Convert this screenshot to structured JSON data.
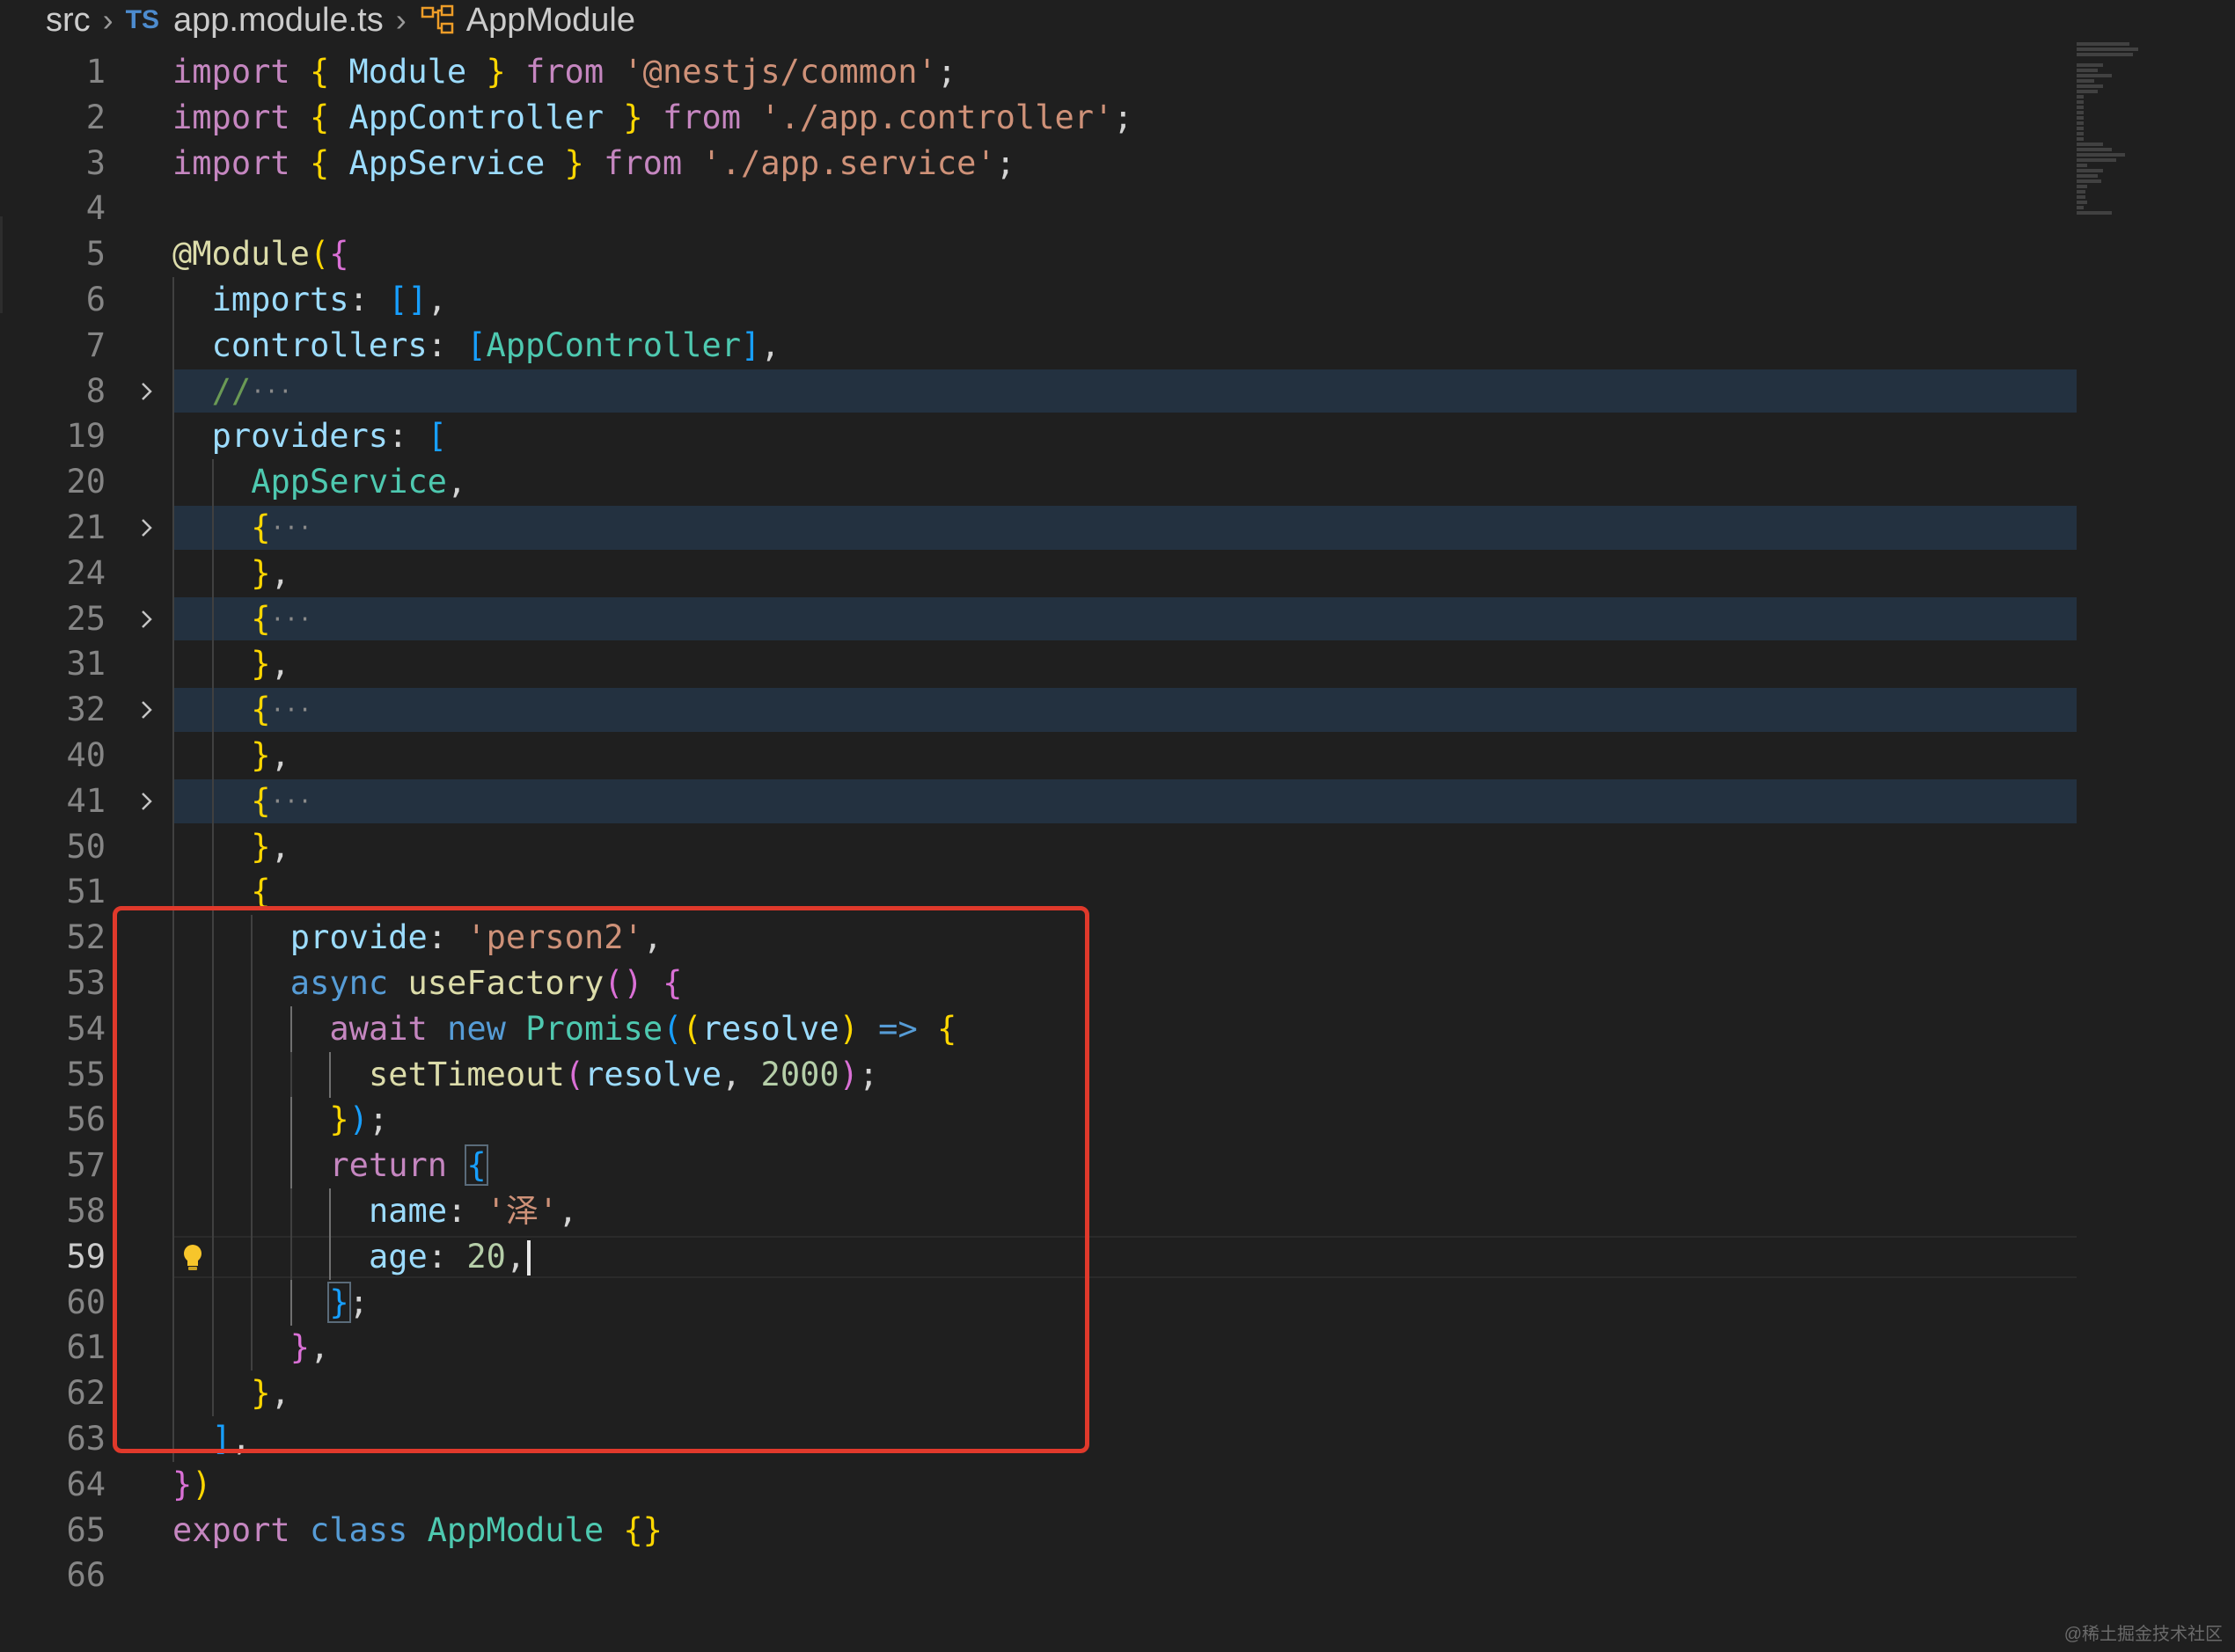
{
  "breadcrumb": {
    "folder": "src",
    "file_badge": "TS",
    "file": "app.module.ts",
    "symbol": "AppModule"
  },
  "code_lines": [
    {
      "n": "1",
      "indent": 0,
      "tokens": [
        [
          "k-ctrl",
          "import"
        ],
        [
          "t-punc",
          " "
        ],
        [
          "b1",
          "{"
        ],
        [
          "t-punc",
          " "
        ],
        [
          "t-var",
          "Module"
        ],
        [
          "t-punc",
          " "
        ],
        [
          "b1",
          "}"
        ],
        [
          "t-punc",
          " "
        ],
        [
          "k-ctrl",
          "from"
        ],
        [
          "t-punc",
          " "
        ],
        [
          "t-str",
          "'@nestjs/common'"
        ],
        [
          "t-punc",
          ";"
        ]
      ]
    },
    {
      "n": "2",
      "indent": 0,
      "tokens": [
        [
          "k-ctrl",
          "import"
        ],
        [
          "t-punc",
          " "
        ],
        [
          "b1",
          "{"
        ],
        [
          "t-punc",
          " "
        ],
        [
          "t-var",
          "AppController"
        ],
        [
          "t-punc",
          " "
        ],
        [
          "b1",
          "}"
        ],
        [
          "t-punc",
          " "
        ],
        [
          "k-ctrl",
          "from"
        ],
        [
          "t-punc",
          " "
        ],
        [
          "t-str",
          "'./app.controller'"
        ],
        [
          "t-punc",
          ";"
        ]
      ]
    },
    {
      "n": "3",
      "indent": 0,
      "tokens": [
        [
          "k-ctrl",
          "import"
        ],
        [
          "t-punc",
          " "
        ],
        [
          "b1",
          "{"
        ],
        [
          "t-punc",
          " "
        ],
        [
          "t-var",
          "AppService"
        ],
        [
          "t-punc",
          " "
        ],
        [
          "b1",
          "}"
        ],
        [
          "t-punc",
          " "
        ],
        [
          "k-ctrl",
          "from"
        ],
        [
          "t-punc",
          " "
        ],
        [
          "t-str",
          "'./app.service'"
        ],
        [
          "t-punc",
          ";"
        ]
      ]
    },
    {
      "n": "4",
      "indent": 0,
      "tokens": []
    },
    {
      "n": "5",
      "indent": 0,
      "tokens": [
        [
          "t-fn",
          "@Module"
        ],
        [
          "b1",
          "("
        ],
        [
          "b2",
          "{"
        ]
      ]
    },
    {
      "n": "6",
      "indent": 1,
      "tokens": [
        [
          "t-var",
          "imports"
        ],
        [
          "t-punc",
          ": "
        ],
        [
          "b3",
          "[]"
        ],
        [
          "t-punc",
          ","
        ]
      ]
    },
    {
      "n": "7",
      "indent": 1,
      "tokens": [
        [
          "t-var",
          "controllers"
        ],
        [
          "t-punc",
          ": "
        ],
        [
          "b3",
          "["
        ],
        [
          "t-type",
          "AppController"
        ],
        [
          "b3",
          "]"
        ],
        [
          "t-punc",
          ","
        ]
      ]
    },
    {
      "n": "8",
      "indent": 1,
      "fold": true,
      "folded": true,
      "tokens": [
        [
          "t-com",
          "//"
        ],
        [
          "ellip",
          "···"
        ]
      ]
    },
    {
      "n": "19",
      "indent": 1,
      "tokens": [
        [
          "t-var",
          "providers"
        ],
        [
          "t-punc",
          ": "
        ],
        [
          "b3",
          "["
        ]
      ]
    },
    {
      "n": "20",
      "indent": 2,
      "tokens": [
        [
          "t-type",
          "AppService"
        ],
        [
          "t-punc",
          ","
        ]
      ]
    },
    {
      "n": "21",
      "indent": 2,
      "fold": true,
      "folded": true,
      "tokens": [
        [
          "b1",
          "{"
        ],
        [
          "ellip",
          "···"
        ]
      ]
    },
    {
      "n": "24",
      "indent": 2,
      "tokens": [
        [
          "b1",
          "}"
        ],
        [
          "t-punc",
          ","
        ]
      ]
    },
    {
      "n": "25",
      "indent": 2,
      "fold": true,
      "folded": true,
      "tokens": [
        [
          "b1",
          "{"
        ],
        [
          "ellip",
          "···"
        ]
      ]
    },
    {
      "n": "31",
      "indent": 2,
      "tokens": [
        [
          "b1",
          "}"
        ],
        [
          "t-punc",
          ","
        ]
      ]
    },
    {
      "n": "32",
      "indent": 2,
      "fold": true,
      "folded": true,
      "tokens": [
        [
          "b1",
          "{"
        ],
        [
          "ellip",
          "···"
        ]
      ]
    },
    {
      "n": "40",
      "indent": 2,
      "tokens": [
        [
          "b1",
          "}"
        ],
        [
          "t-punc",
          ","
        ]
      ]
    },
    {
      "n": "41",
      "indent": 2,
      "fold": true,
      "folded": true,
      "tokens": [
        [
          "b1",
          "{"
        ],
        [
          "ellip",
          "···"
        ]
      ]
    },
    {
      "n": "50",
      "indent": 2,
      "tokens": [
        [
          "b1",
          "}"
        ],
        [
          "t-punc",
          ","
        ]
      ]
    },
    {
      "n": "51",
      "indent": 2,
      "tokens": [
        [
          "b1",
          "{"
        ]
      ]
    },
    {
      "n": "52",
      "indent": 3,
      "tokens": [
        [
          "t-var",
          "provide"
        ],
        [
          "t-punc",
          ": "
        ],
        [
          "t-str",
          "'person2'"
        ],
        [
          "t-punc",
          ","
        ]
      ]
    },
    {
      "n": "53",
      "indent": 3,
      "tokens": [
        [
          "k-store",
          "async"
        ],
        [
          "t-punc",
          " "
        ],
        [
          "t-fn",
          "useFactory"
        ],
        [
          "b2",
          "()"
        ],
        [
          "t-punc",
          " "
        ],
        [
          "b2",
          "{"
        ]
      ]
    },
    {
      "n": "54",
      "indent": 4,
      "tokens": [
        [
          "k-ctrl",
          "await"
        ],
        [
          "t-punc",
          " "
        ],
        [
          "k-store",
          "new"
        ],
        [
          "t-punc",
          " "
        ],
        [
          "t-type",
          "Promise"
        ],
        [
          "b3",
          "("
        ],
        [
          "b1",
          "("
        ],
        [
          "t-var",
          "resolve"
        ],
        [
          "b1",
          ")"
        ],
        [
          "t-punc",
          " "
        ],
        [
          "k-store",
          "=>"
        ],
        [
          "t-punc",
          " "
        ],
        [
          "b1",
          "{"
        ]
      ]
    },
    {
      "n": "55",
      "indent": 5,
      "tokens": [
        [
          "t-fn",
          "setTimeout"
        ],
        [
          "b2",
          "("
        ],
        [
          "t-var",
          "resolve"
        ],
        [
          "t-punc",
          ", "
        ],
        [
          "t-num",
          "2000"
        ],
        [
          "b2",
          ")"
        ],
        [
          "t-punc",
          ";"
        ]
      ]
    },
    {
      "n": "56",
      "indent": 4,
      "tokens": [
        [
          "b1",
          "}"
        ],
        [
          "b3",
          ")"
        ],
        [
          "t-punc",
          ";"
        ]
      ]
    },
    {
      "n": "57",
      "indent": 4,
      "tokens": [
        [
          "k-ctrl",
          "return"
        ],
        [
          "t-punc",
          " "
        ],
        [
          "b3",
          "{"
        ]
      ]
    },
    {
      "n": "58",
      "indent": 5,
      "tokens": [
        [
          "t-var",
          "name"
        ],
        [
          "t-punc",
          ": "
        ],
        [
          "t-str",
          "'泽'"
        ],
        [
          "t-punc",
          ","
        ]
      ]
    },
    {
      "n": "59",
      "indent": 5,
      "current": true,
      "bulb": true,
      "cursor": true,
      "tokens": [
        [
          "t-var",
          "age"
        ],
        [
          "t-punc",
          ": "
        ],
        [
          "t-num",
          "20"
        ],
        [
          "t-punc",
          ","
        ]
      ]
    },
    {
      "n": "60",
      "indent": 4,
      "tokens": [
        [
          "b3",
          "}"
        ],
        [
          "t-punc",
          ";"
        ]
      ]
    },
    {
      "n": "61",
      "indent": 3,
      "tokens": [
        [
          "b2",
          "}"
        ],
        [
          "t-punc",
          ","
        ]
      ]
    },
    {
      "n": "62",
      "indent": 2,
      "tokens": [
        [
          "b1",
          "}"
        ],
        [
          "t-punc",
          ","
        ]
      ]
    },
    {
      "n": "63",
      "indent": 1,
      "tokens": [
        [
          "b3",
          "]"
        ],
        [
          "t-punc",
          ","
        ]
      ]
    },
    {
      "n": "64",
      "indent": 0,
      "tokens": [
        [
          "b2",
          "}"
        ],
        [
          "b1",
          ")"
        ]
      ]
    },
    {
      "n": "65",
      "indent": 0,
      "tokens": [
        [
          "k-ctrl",
          "export"
        ],
        [
          "t-punc",
          " "
        ],
        [
          "k-store",
          "class"
        ],
        [
          "t-punc",
          " "
        ],
        [
          "t-type",
          "AppModule"
        ],
        [
          "t-punc",
          " "
        ],
        [
          "b1",
          "{}"
        ]
      ]
    },
    {
      "n": "66",
      "indent": 0,
      "tokens": []
    }
  ],
  "annotation": {
    "box_color": "#e0392b"
  },
  "watermark": "@稀土掘金技术社区"
}
